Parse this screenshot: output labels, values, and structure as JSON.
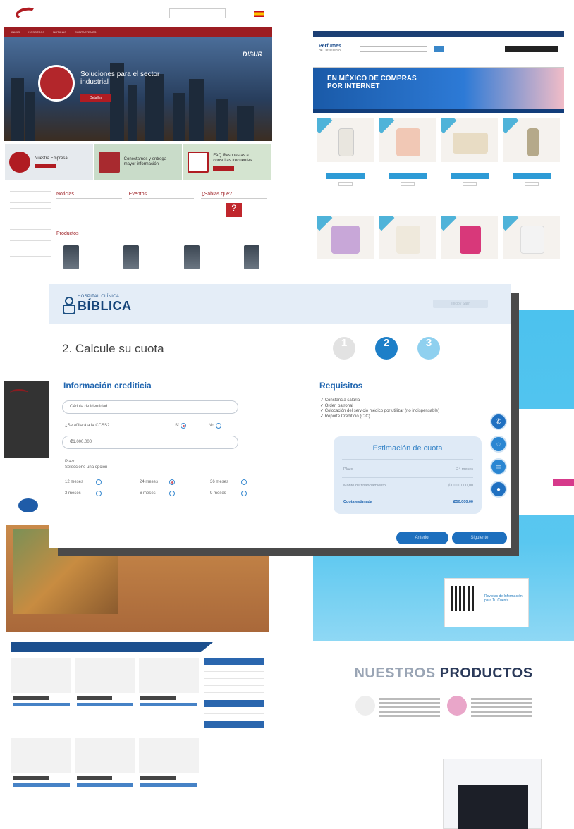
{
  "disur": {
    "nav": [
      "INICIO",
      "NOSOTROS",
      "NOTICIAS",
      "CONTACTENOS"
    ],
    "hero_text": "Soluciones para el sector industrial",
    "hero_button": "Detalles",
    "hero_brand": "DISUR",
    "tiles": [
      {
        "label": "Nuestra Empresa",
        "button": "Detalles"
      },
      {
        "label": "Conectamos y entrega mayor información",
        "button": ""
      },
      {
        "label": "FAQ Respuestas a consultas frecuentes",
        "button": "Detalles"
      }
    ],
    "sections": {
      "news": "Noticias",
      "events": "Eventos",
      "know": "¿Sabías que?",
      "products": "Productos"
    }
  },
  "perfumes": {
    "brand": "Perfumes",
    "brand_sub": "de Descuento",
    "banner": "EN MÉXICO DE COMPRAS POR INTERNET"
  },
  "blue_site": {
    "section_title_light": "NUESTROS",
    "section_title_bold": "PRODUCTOS",
    "qr_text": "Revistas de Información para Tu Cuenta"
  },
  "hospital": {
    "logo_small": "HOSPITAL CLÍNICA",
    "logo_big": "BÍBLICA",
    "header_link": "Inicio / Salir",
    "step_title": "2. Calcule su cuota",
    "steps": [
      "1",
      "2",
      "3"
    ],
    "credit": {
      "title": "Información crediticia",
      "field1": "Cédula de identidad",
      "question": "¿Se afiliará a la CCSS?",
      "yes": "Sí",
      "no": "No",
      "amount": "₡1.000.000",
      "term_label": "Plazo",
      "term_hint": "Seleccione una opción",
      "terms": [
        "12 meses",
        "24 meses",
        "36 meses",
        "3 meses",
        "6 meses",
        "9 meses"
      ]
    },
    "requirements": {
      "title": "Requisitos",
      "items": [
        "✓ Constancia salarial",
        "✓ Orden patronal",
        "✓ Colocación del servicio médico por utilizar (no indispensable)",
        "✓ Reporte Crediticio (CIC)"
      ]
    },
    "estimate": {
      "title": "Estimación de cuota",
      "rows": [
        {
          "label": "Plazo",
          "value": "24 meses"
        },
        {
          "label": "Monto de financiamiento",
          "value": "₡1.000.000,00"
        },
        {
          "label": "Cuota estimada",
          "value": "₡50.000,00"
        }
      ]
    },
    "buttons": {
      "back": "Anterior",
      "next": "Siguiente"
    }
  },
  "colors": {
    "brand_blue": "#1d6fbe",
    "step_active": "#1d7fc8",
    "step_future": "#8fd0ef",
    "disur_red": "#9c1d22"
  }
}
